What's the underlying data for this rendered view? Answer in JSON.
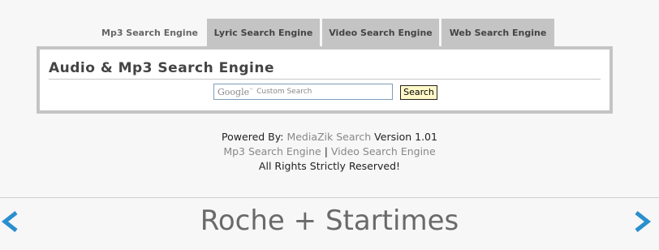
{
  "tabs": [
    {
      "label": "Mp3 Search Engine",
      "active": true
    },
    {
      "label": "Lyric Search Engine",
      "active": false
    },
    {
      "label": "Video Search Engine",
      "active": false
    },
    {
      "label": "Web Search Engine",
      "active": false
    }
  ],
  "panel": {
    "title": "Audio & Mp3 Search Engine",
    "search": {
      "logo_text": "Google",
      "placeholder": "Custom Search",
      "button_label": "Search"
    }
  },
  "footer": {
    "powered_prefix": "Powered By:",
    "powered_link": "MediaZik Search",
    "version": "Version 1.01",
    "link1": "Mp3 Search Engine",
    "separator": "|",
    "link2": "Video Search Engine",
    "rights": "All Rights Strictly Reserved!"
  },
  "banner": {
    "title": "Roche + Startimes"
  },
  "colors": {
    "tab_bg": "#c4c4c4",
    "arrow": "#2a8fce",
    "button_bg": "#fff9c8"
  },
  "icons": {
    "prev": "chevron-left-icon",
    "next": "chevron-right-icon"
  }
}
